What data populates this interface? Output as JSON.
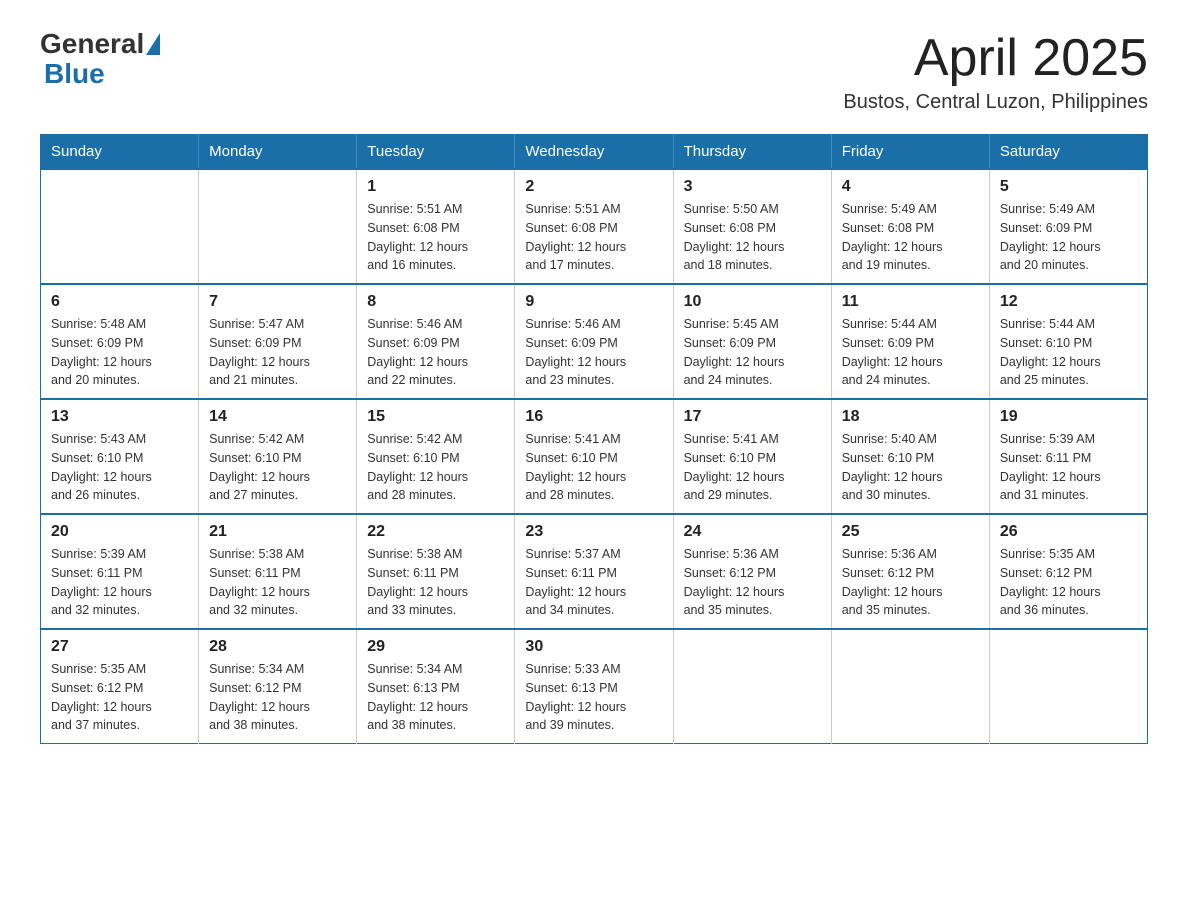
{
  "header": {
    "logo_general": "General",
    "logo_blue": "Blue",
    "month_title": "April 2025",
    "subtitle": "Bustos, Central Luzon, Philippines"
  },
  "days_of_week": [
    "Sunday",
    "Monday",
    "Tuesday",
    "Wednesday",
    "Thursday",
    "Friday",
    "Saturday"
  ],
  "weeks": [
    [
      {
        "day": "",
        "info": ""
      },
      {
        "day": "",
        "info": ""
      },
      {
        "day": "1",
        "info": "Sunrise: 5:51 AM\nSunset: 6:08 PM\nDaylight: 12 hours\nand 16 minutes."
      },
      {
        "day": "2",
        "info": "Sunrise: 5:51 AM\nSunset: 6:08 PM\nDaylight: 12 hours\nand 17 minutes."
      },
      {
        "day": "3",
        "info": "Sunrise: 5:50 AM\nSunset: 6:08 PM\nDaylight: 12 hours\nand 18 minutes."
      },
      {
        "day": "4",
        "info": "Sunrise: 5:49 AM\nSunset: 6:08 PM\nDaylight: 12 hours\nand 19 minutes."
      },
      {
        "day": "5",
        "info": "Sunrise: 5:49 AM\nSunset: 6:09 PM\nDaylight: 12 hours\nand 20 minutes."
      }
    ],
    [
      {
        "day": "6",
        "info": "Sunrise: 5:48 AM\nSunset: 6:09 PM\nDaylight: 12 hours\nand 20 minutes."
      },
      {
        "day": "7",
        "info": "Sunrise: 5:47 AM\nSunset: 6:09 PM\nDaylight: 12 hours\nand 21 minutes."
      },
      {
        "day": "8",
        "info": "Sunrise: 5:46 AM\nSunset: 6:09 PM\nDaylight: 12 hours\nand 22 minutes."
      },
      {
        "day": "9",
        "info": "Sunrise: 5:46 AM\nSunset: 6:09 PM\nDaylight: 12 hours\nand 23 minutes."
      },
      {
        "day": "10",
        "info": "Sunrise: 5:45 AM\nSunset: 6:09 PM\nDaylight: 12 hours\nand 24 minutes."
      },
      {
        "day": "11",
        "info": "Sunrise: 5:44 AM\nSunset: 6:09 PM\nDaylight: 12 hours\nand 24 minutes."
      },
      {
        "day": "12",
        "info": "Sunrise: 5:44 AM\nSunset: 6:10 PM\nDaylight: 12 hours\nand 25 minutes."
      }
    ],
    [
      {
        "day": "13",
        "info": "Sunrise: 5:43 AM\nSunset: 6:10 PM\nDaylight: 12 hours\nand 26 minutes."
      },
      {
        "day": "14",
        "info": "Sunrise: 5:42 AM\nSunset: 6:10 PM\nDaylight: 12 hours\nand 27 minutes."
      },
      {
        "day": "15",
        "info": "Sunrise: 5:42 AM\nSunset: 6:10 PM\nDaylight: 12 hours\nand 28 minutes."
      },
      {
        "day": "16",
        "info": "Sunrise: 5:41 AM\nSunset: 6:10 PM\nDaylight: 12 hours\nand 28 minutes."
      },
      {
        "day": "17",
        "info": "Sunrise: 5:41 AM\nSunset: 6:10 PM\nDaylight: 12 hours\nand 29 minutes."
      },
      {
        "day": "18",
        "info": "Sunrise: 5:40 AM\nSunset: 6:10 PM\nDaylight: 12 hours\nand 30 minutes."
      },
      {
        "day": "19",
        "info": "Sunrise: 5:39 AM\nSunset: 6:11 PM\nDaylight: 12 hours\nand 31 minutes."
      }
    ],
    [
      {
        "day": "20",
        "info": "Sunrise: 5:39 AM\nSunset: 6:11 PM\nDaylight: 12 hours\nand 32 minutes."
      },
      {
        "day": "21",
        "info": "Sunrise: 5:38 AM\nSunset: 6:11 PM\nDaylight: 12 hours\nand 32 minutes."
      },
      {
        "day": "22",
        "info": "Sunrise: 5:38 AM\nSunset: 6:11 PM\nDaylight: 12 hours\nand 33 minutes."
      },
      {
        "day": "23",
        "info": "Sunrise: 5:37 AM\nSunset: 6:11 PM\nDaylight: 12 hours\nand 34 minutes."
      },
      {
        "day": "24",
        "info": "Sunrise: 5:36 AM\nSunset: 6:12 PM\nDaylight: 12 hours\nand 35 minutes."
      },
      {
        "day": "25",
        "info": "Sunrise: 5:36 AM\nSunset: 6:12 PM\nDaylight: 12 hours\nand 35 minutes."
      },
      {
        "day": "26",
        "info": "Sunrise: 5:35 AM\nSunset: 6:12 PM\nDaylight: 12 hours\nand 36 minutes."
      }
    ],
    [
      {
        "day": "27",
        "info": "Sunrise: 5:35 AM\nSunset: 6:12 PM\nDaylight: 12 hours\nand 37 minutes."
      },
      {
        "day": "28",
        "info": "Sunrise: 5:34 AM\nSunset: 6:12 PM\nDaylight: 12 hours\nand 38 minutes."
      },
      {
        "day": "29",
        "info": "Sunrise: 5:34 AM\nSunset: 6:13 PM\nDaylight: 12 hours\nand 38 minutes."
      },
      {
        "day": "30",
        "info": "Sunrise: 5:33 AM\nSunset: 6:13 PM\nDaylight: 12 hours\nand 39 minutes."
      },
      {
        "day": "",
        "info": ""
      },
      {
        "day": "",
        "info": ""
      },
      {
        "day": "",
        "info": ""
      }
    ]
  ]
}
